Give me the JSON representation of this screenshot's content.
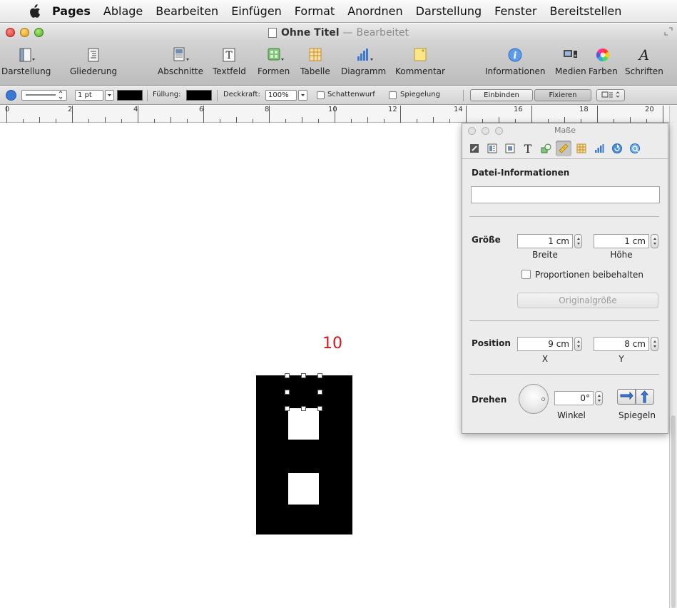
{
  "menubar": {
    "app_name": "Pages",
    "items": [
      "Ablage",
      "Bearbeiten",
      "Einfügen",
      "Format",
      "Anordnen",
      "Darstellung",
      "Fenster",
      "Bereitstellen"
    ]
  },
  "window": {
    "title": "Ohne Titel",
    "separator": "—",
    "status": "Bearbeitet"
  },
  "toolbar": {
    "buttons": [
      {
        "label": "Darstellung"
      },
      {
        "label": "Gliederung"
      },
      {
        "label": "Abschnitte"
      },
      {
        "label": "Textfeld"
      },
      {
        "label": "Formen"
      },
      {
        "label": "Tabelle"
      },
      {
        "label": "Diagramm"
      },
      {
        "label": "Kommentar"
      },
      {
        "label": "Informationen"
      },
      {
        "label": "Medien"
      },
      {
        "label": "Farben"
      },
      {
        "label": "Schriften"
      }
    ]
  },
  "formatbar": {
    "stroke_width": "1 pt",
    "fill_label": "Füllung:",
    "opacity_label": "Deckkraft:",
    "opacity_value": "100%",
    "shadow_label": "Schattenwurf",
    "reflection_label": "Spiegelung",
    "inline_label": "Einbinden",
    "fixed_label": "Fixieren"
  },
  "ruler": {
    "labels": [
      "0",
      "2",
      "4",
      "6",
      "8",
      "10",
      "12",
      "14",
      "16",
      "18",
      "20"
    ]
  },
  "document": {
    "page_number": "10"
  },
  "inspector": {
    "title": "Maße",
    "file_info_title": "Datei-Informationen",
    "file_info_value": "",
    "size_title": "Größe",
    "width_value": "1 cm",
    "height_value": "1 cm",
    "width_label": "Breite",
    "height_label": "Höhe",
    "constrain_label": "Proportionen beibehalten",
    "original_size_label": "Originalgröße",
    "position_title": "Position",
    "x_value": "9 cm",
    "y_value": "8 cm",
    "x_label": "X",
    "y_label": "Y",
    "rotate_title": "Drehen",
    "angle_value": "0°",
    "angle_label": "Winkel",
    "flip_label": "Spiegeln"
  },
  "colors": {
    "page_number": "#d1161c",
    "shape_fill": "#000000"
  }
}
